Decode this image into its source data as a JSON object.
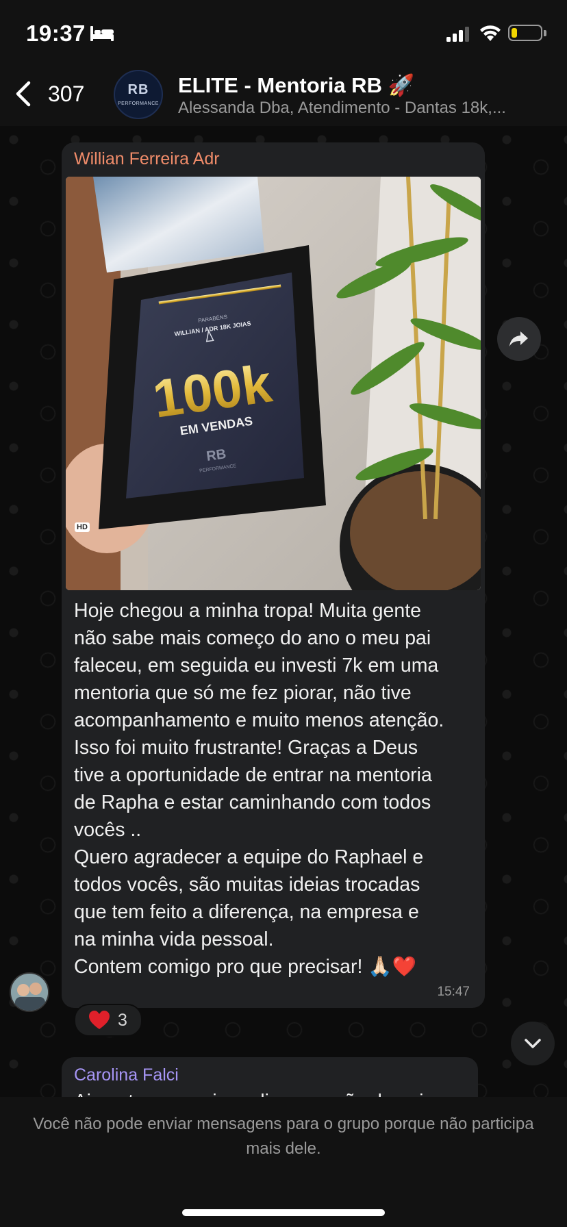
{
  "status_bar": {
    "time": "19:37",
    "battery_level": 0.2,
    "battery_color": "#f2d600"
  },
  "header": {
    "back_count": "307",
    "group_name": "ELITE - Mentoria RB 🚀",
    "members_preview": "Alessanda Dba, Atendimento - Dantas 18k,...",
    "avatar_logo": "RB",
    "avatar_logo_sub": "PERFORMANCE"
  },
  "message": {
    "sender": "Willian Ferreira Adr",
    "sender_color": "#f08c6a",
    "photo": {
      "frame_top_label": "PARABÉNS",
      "frame_name": "WILLIAN / ADR 18K JOIAS",
      "frame_big": "100k",
      "frame_sub": "EM VENDAS",
      "frame_logo": "RB",
      "frame_logo_sub": "PERFORMANCE",
      "hd_badge": "HD"
    },
    "text": "Hoje chegou a minha tropa! Muita gente\nnão sabe mais começo do ano o meu pai\nfaleceu, em seguida eu investi 7k em uma\nmentoria que só me fez piorar, não tive\nacompanhamento e muito menos atenção.\nIsso foi muito frustrante! Graças a Deus\ntive a oportunidade de entrar na mentoria\nde Rapha e estar caminhando com todos\nvocês ..\nQuero agradecer a equipe do Raphael e\ntodos vocês, são muitas ideias trocadas\nque tem feito a diferença, na empresa e\nna minha vida pessoal.\nContem comigo pro que precisar! 🙏🏻❤️",
    "time": "15:47",
    "reaction": {
      "emoji": "heart-icon",
      "count": "3"
    }
  },
  "next_message": {
    "sender": "Carolina Falci",
    "sender_color": "#a695f4",
    "text_partial": "Ai gente nem sei o q dizer vcs são demais"
  },
  "footer": {
    "notice": "Você não pode enviar mensagens para o grupo porque não participa mais dele."
  }
}
